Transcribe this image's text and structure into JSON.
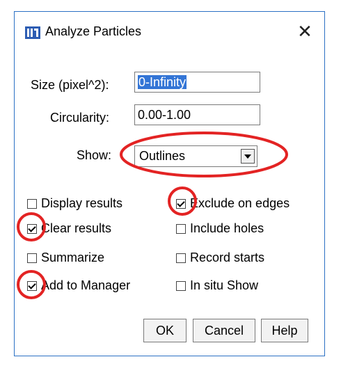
{
  "window": {
    "title": "Analyze Particles",
    "close_glyph": "✕"
  },
  "fields": {
    "size_label": "Size (pixel^2):",
    "size_value": "0-Infinity",
    "circularity_label": "Circularity:",
    "circularity_value": "0.00-1.00",
    "show_label": "Show:",
    "show_value": "Outlines"
  },
  "checkboxes": {
    "display_results": {
      "label": "Display results",
      "checked": false
    },
    "clear_results": {
      "label": "Clear results",
      "checked": true
    },
    "summarize": {
      "label": "Summarize",
      "checked": false
    },
    "add_to_manager": {
      "label": "Add to Manager",
      "checked": true
    },
    "exclude_on_edges": {
      "label": "Exclude on edges",
      "checked": true
    },
    "include_holes": {
      "label": "Include holes",
      "checked": false
    },
    "record_starts": {
      "label": "Record starts",
      "checked": false
    },
    "in_situ_show": {
      "label": "In situ Show",
      "checked": false
    }
  },
  "buttons": {
    "ok": "OK",
    "cancel": "Cancel",
    "help": "Help"
  },
  "colors": {
    "annotation_red": "#e32323",
    "selection_blue": "#3375d6",
    "window_border": "#2b70c4"
  },
  "icons": {
    "app": "imagej-icon",
    "close": "close-icon"
  }
}
